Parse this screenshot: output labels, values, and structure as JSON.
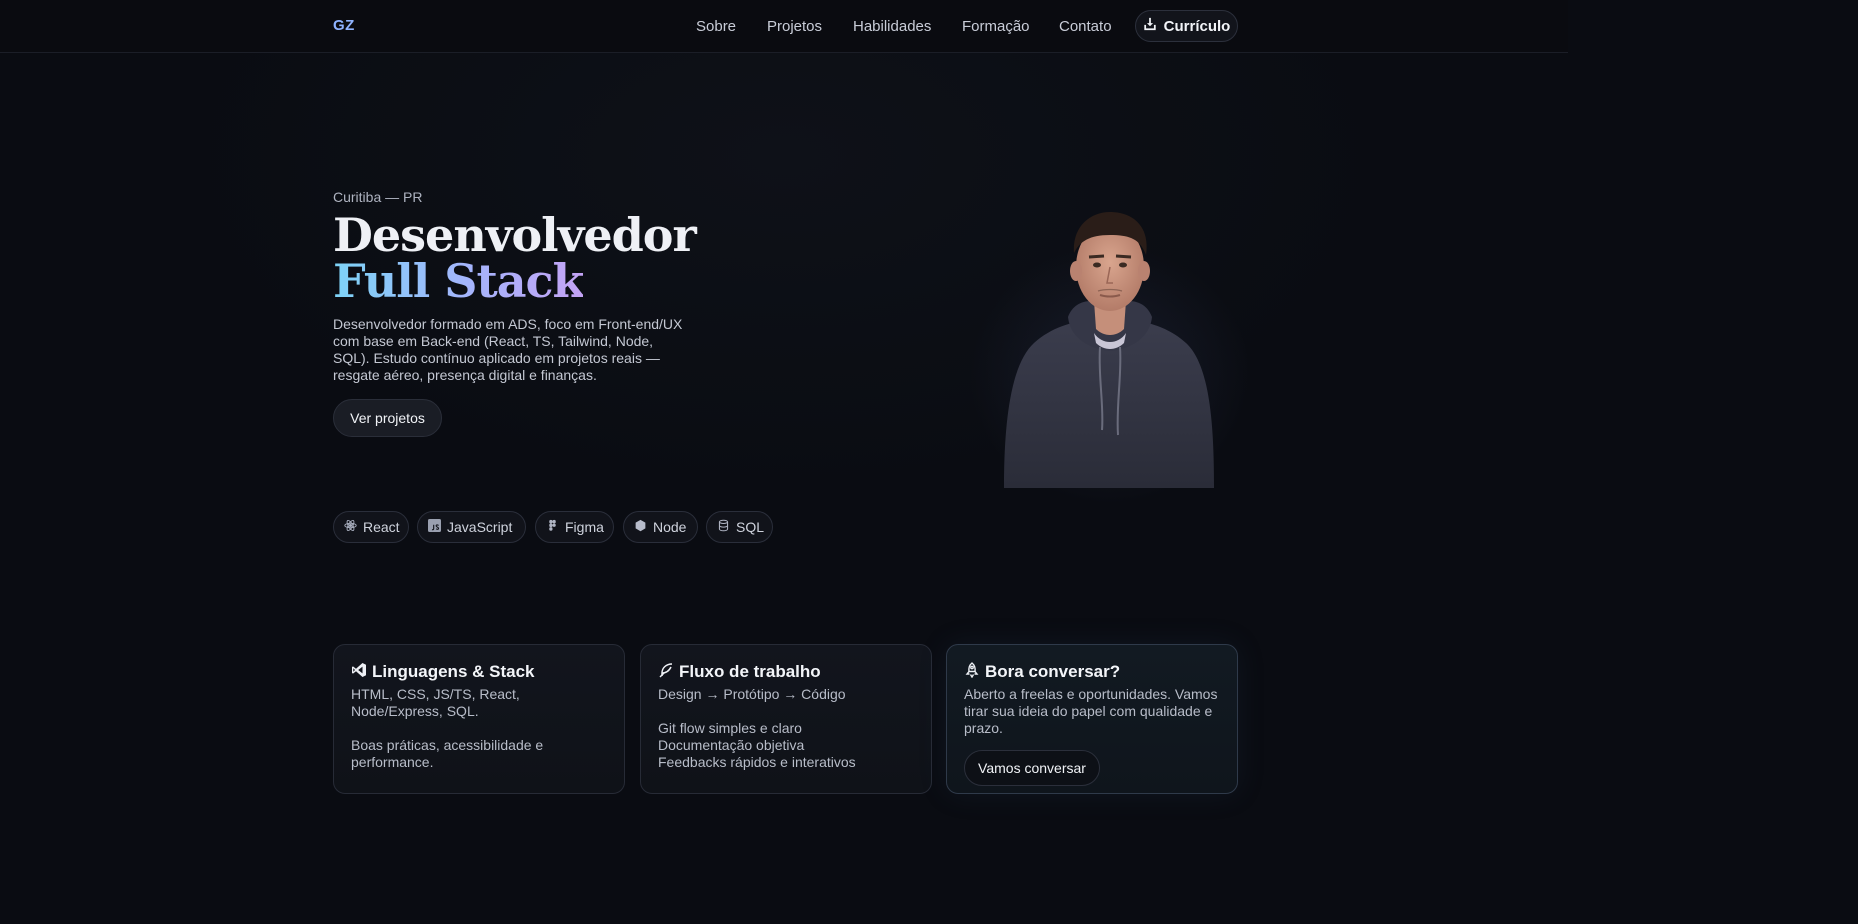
{
  "nav": {
    "logo": "GZ",
    "links": [
      "Sobre",
      "Projetos",
      "Habilidades",
      "Formação",
      "Contato"
    ],
    "cv_label": "Currículo"
  },
  "hero": {
    "location": "Curitiba — PR",
    "title_line1": "Desenvolvedor",
    "title_line2": "Full Stack",
    "description": "Desenvolvedor formado em ADS, foco em Front-end/UX com base em Back-end (React, TS, Tailwind, Node, SQL). Estudo contínuo aplicado em projetos reais — resgate aéreo, presença digital e finanças.",
    "cta_label": "Ver projetos"
  },
  "tech_chips": [
    {
      "label": "React",
      "icon": "react-icon"
    },
    {
      "label": "JavaScript",
      "icon": "javascript-icon"
    },
    {
      "label": "Figma",
      "icon": "figma-icon"
    },
    {
      "label": "Node",
      "icon": "node-icon"
    },
    {
      "label": "SQL",
      "icon": "database-icon"
    }
  ],
  "cards": [
    {
      "title": "Linguagens & Stack",
      "icon": "vscode-icon",
      "para1": "HTML, CSS, JS/TS, React, Node/Express, SQL.",
      "para2": "Boas práticas, acessibilidade e performance."
    },
    {
      "title": "Fluxo de trabalho",
      "icon": "feather-icon",
      "para1": "Design → Protótipo → Código",
      "lines": [
        "Git flow simples e claro",
        "Documentação objetiva",
        "Feedbacks rápidos e interativos"
      ]
    },
    {
      "title": "Bora conversar?",
      "icon": "rocket-icon",
      "para1": "Aberto a freelas e oportunidades. Vamos tirar sua ideia do papel com qualidade e prazo.",
      "button": "Vamos conversar"
    }
  ],
  "colors": {
    "background": "#0a0c12",
    "logo": "#8fb3ff",
    "gradient_start": "#7dd3f7",
    "gradient_end": "#c4a3f5"
  }
}
